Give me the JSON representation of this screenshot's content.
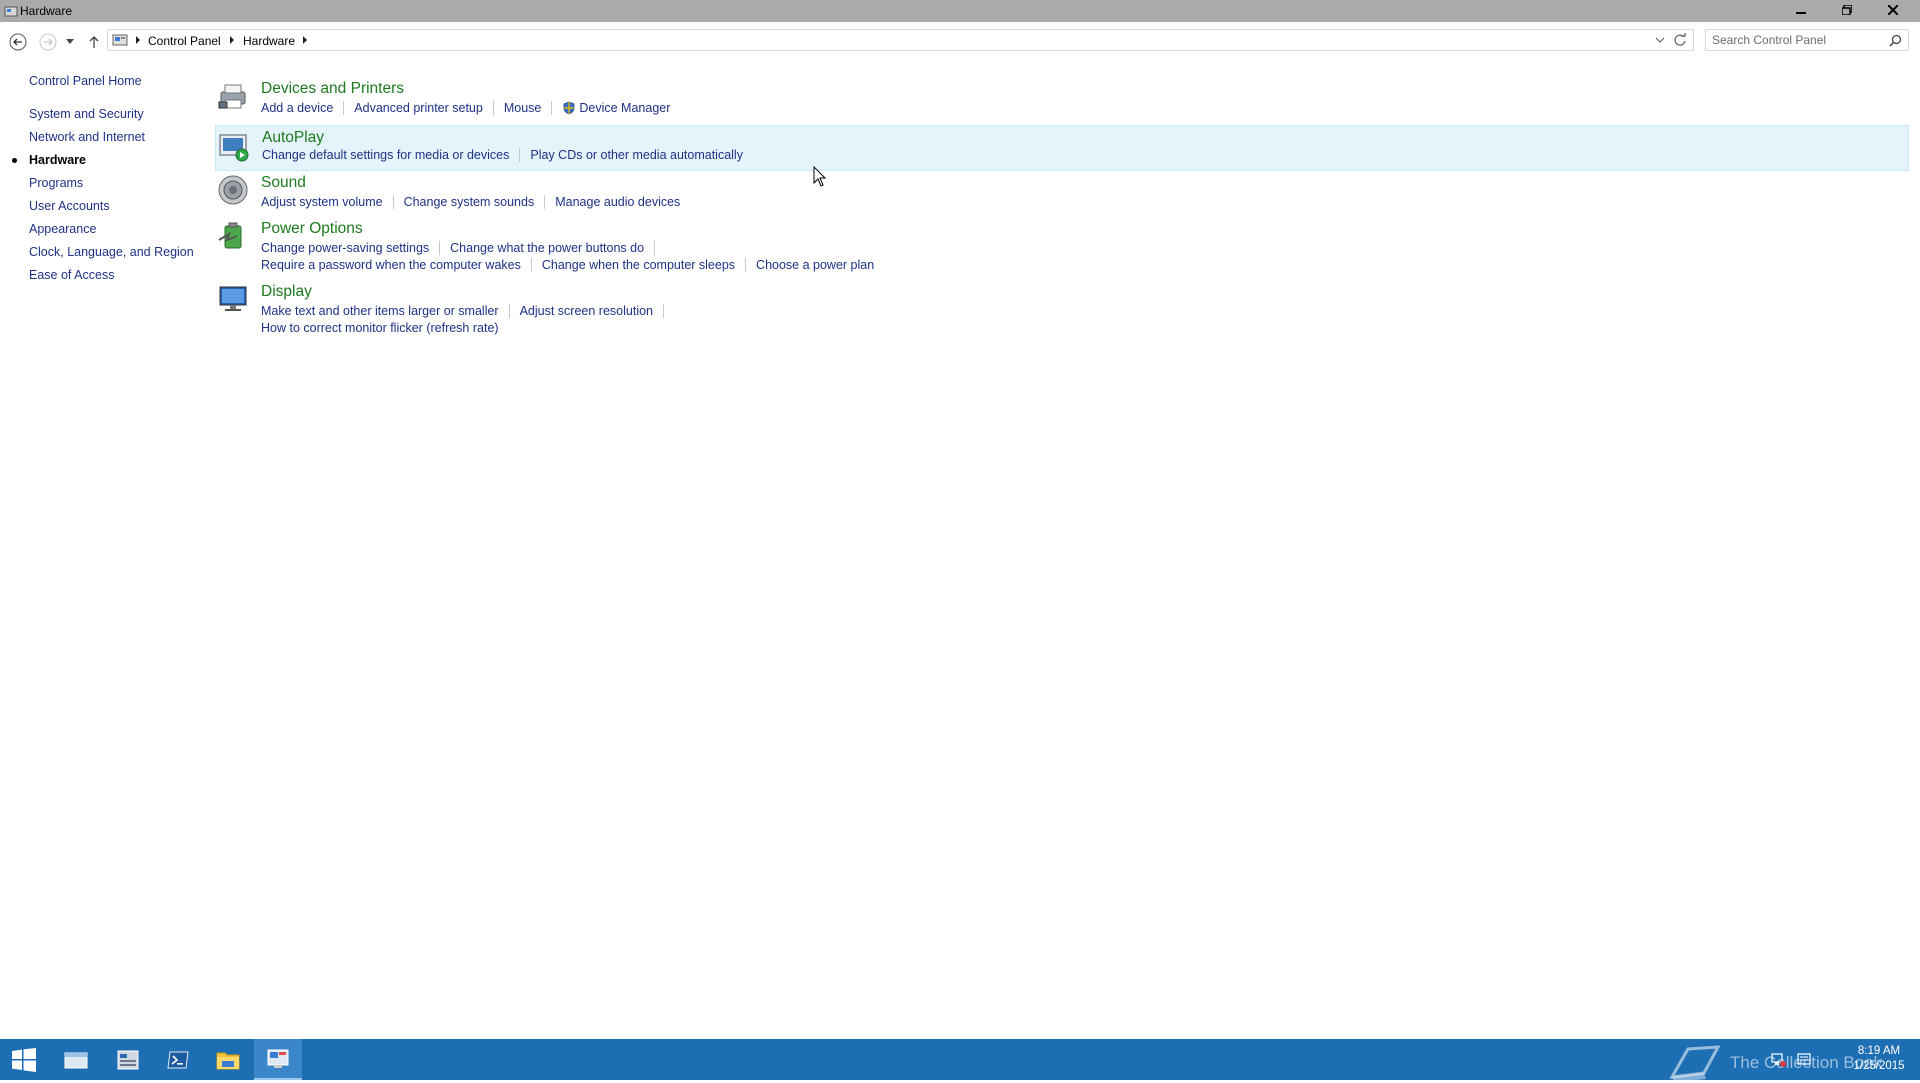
{
  "window": {
    "title": "Hardware",
    "minimize_label": "Minimize",
    "maximize_label": "Restore",
    "close_label": "Close"
  },
  "address": {
    "breadcrumbs": [
      "Control Panel",
      "Hardware"
    ],
    "search_placeholder": "Search Control Panel"
  },
  "sidebar": {
    "home": "Control Panel Home",
    "items": [
      {
        "label": "System and Security",
        "active": false
      },
      {
        "label": "Network and Internet",
        "active": false
      },
      {
        "label": "Hardware",
        "active": true
      },
      {
        "label": "Programs",
        "active": false
      },
      {
        "label": "User Accounts",
        "active": false
      },
      {
        "label": "Appearance",
        "active": false
      },
      {
        "label": "Clock, Language, and Region",
        "active": false
      },
      {
        "label": "Ease of Access",
        "active": false
      }
    ]
  },
  "categories": [
    {
      "title": "Devices and Printers",
      "icon": "printer-icon",
      "rows": [
        [
          "Add a device",
          "Advanced printer setup",
          "Mouse",
          "Device Manager"
        ]
      ]
    },
    {
      "title": "AutoPlay",
      "icon": "autoplay-icon",
      "rows": [
        [
          "Change default settings for media or devices",
          "Play CDs or other media automatically"
        ]
      ]
    },
    {
      "title": "Sound",
      "icon": "speaker-icon",
      "rows": [
        [
          "Adjust system volume",
          "Change system sounds",
          "Manage audio devices"
        ]
      ]
    },
    {
      "title": "Power Options",
      "icon": "battery-icon",
      "rows": [
        [
          "Change power-saving settings",
          "Change what the power buttons do"
        ],
        [
          "Require a password when the computer wakes",
          "Change when the computer sleeps",
          "Choose a power plan"
        ]
      ]
    },
    {
      "title": "Display",
      "icon": "monitor-icon",
      "rows": [
        [
          "Make text and other items larger or smaller",
          "Adjust screen resolution"
        ],
        [
          "How to correct monitor flicker (refresh rate)"
        ]
      ]
    }
  ],
  "taskbar": {
    "watermark": "The Collection Book",
    "time": "8:19 AM",
    "date": "1/25/2015"
  },
  "colors": {
    "link": "#1e3287",
    "category_title": "#1e7a1e",
    "taskbar": "#1e6eb4",
    "highlight": "#e5f3fb"
  }
}
